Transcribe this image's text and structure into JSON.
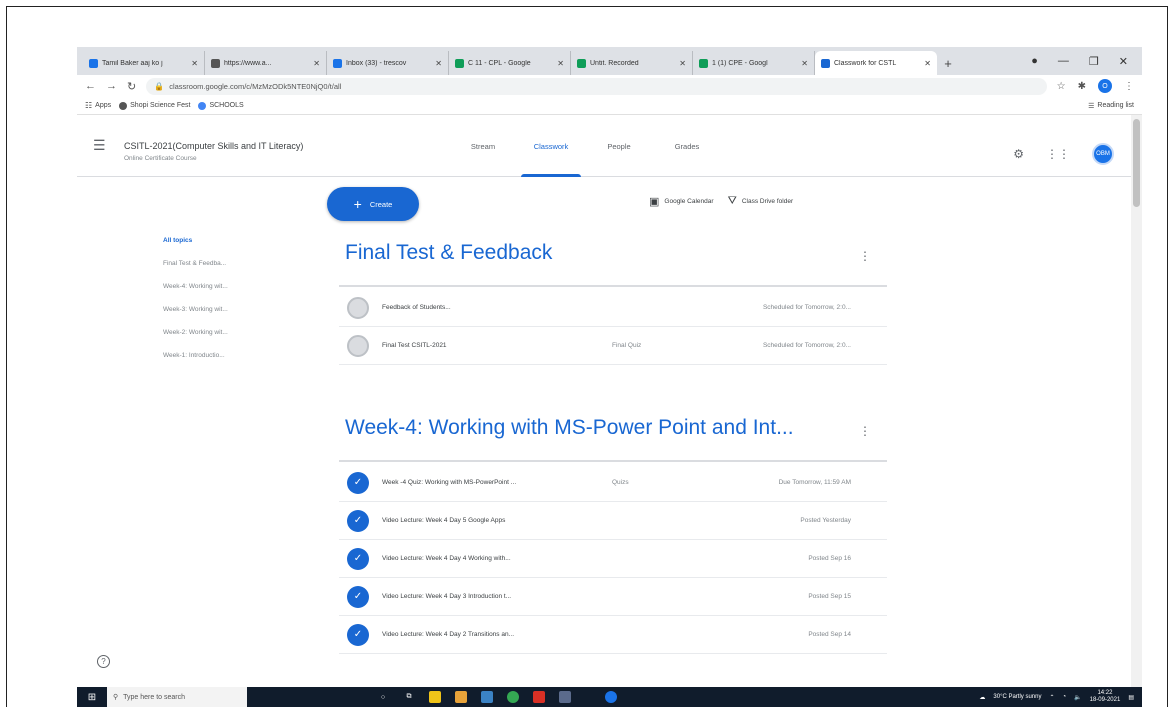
{
  "browser": {
    "tabs": [
      {
        "label": "Tamil Baker aaj ko j",
        "color": "#1a73e8",
        "active": false
      },
      {
        "label": "https://www.a...",
        "color": "#555555",
        "active": false
      },
      {
        "label": "Inbox (33) - trescov",
        "color": "#1a73e8",
        "active": false
      },
      {
        "label": "C 11 - CPL - Google",
        "color": "#0f9d58",
        "active": false
      },
      {
        "label": "Untit. Recorded",
        "color": "#0f9d58",
        "active": false
      },
      {
        "label": "1 (1) CPE - Googl",
        "color": "#0f9d58",
        "active": false
      },
      {
        "label": "Classwork for CSTL",
        "color": "#1967d2",
        "active": true
      }
    ],
    "new_tab": "+",
    "url": "classroom.google.com/c/MzMzODk5NTE0NjQ0/t/all",
    "bookmarks": [
      {
        "label": "Apps"
      },
      {
        "label": "Shopi Science Fest"
      },
      {
        "label": "SCHOOLS"
      }
    ],
    "reading_list": "Reading list"
  },
  "classroom": {
    "course_title": "CSITL-2021(Computer Skills and IT Literacy)",
    "course_subtitle": "Online Certificate Course",
    "nav": [
      "Stream",
      "Classwork",
      "People",
      "Grades"
    ],
    "active_nav": "Classwork",
    "avatar_text": "OBM",
    "create_label": "Create",
    "calendar_link": "Google Calendar",
    "drive_link": "Class Drive folder"
  },
  "topics": [
    {
      "label": "All topics",
      "active": true
    },
    {
      "label": "Final Test & Feedba...",
      "active": false
    },
    {
      "label": "Week-4: Working wit...",
      "active": false
    },
    {
      "label": "Week-3: Working wit...",
      "active": false
    },
    {
      "label": "Week-2: Working wit...",
      "active": false
    },
    {
      "label": "Week-1: Introductio...",
      "active": false
    }
  ],
  "sections": [
    {
      "title": "Final Test & Feedback",
      "items": [
        {
          "title": "Feedback of Students...",
          "tag": "",
          "status": "Scheduled for Tomorrow, 2:0...",
          "icon": "grey"
        },
        {
          "title": "Final Test CSITL-2021",
          "tag": "Final Quiz",
          "status": "Scheduled for Tomorrow, 2:0...",
          "icon": "grey"
        }
      ]
    },
    {
      "title": "Week-4: Working with MS-Power Point and Int...",
      "items": [
        {
          "title": "Week -4 Quiz: Working with MS-PowerPoint ...",
          "tag": "Quizs",
          "status": "Due Tomorrow, 11:59 AM",
          "icon": "blue"
        },
        {
          "title": "Video Lecture: Week 4 Day 5 Google Apps",
          "tag": "",
          "status": "Posted Yesterday",
          "icon": "blue"
        },
        {
          "title": "Video Lecture: Week 4 Day 4 Working with...",
          "tag": "",
          "status": "Posted Sep 16",
          "icon": "blue"
        },
        {
          "title": "Video Lecture: Week 4 Day 3 Introduction t...",
          "tag": "",
          "status": "Posted Sep 15",
          "icon": "blue"
        },
        {
          "title": "Video Lecture: Week 4 Day 2 Transitions an...",
          "tag": "",
          "status": "Posted Sep 14",
          "icon": "blue"
        }
      ]
    }
  ],
  "taskbar": {
    "search_placeholder": "Type here to search",
    "weather": "30°C Partly sunny",
    "time": "14:22",
    "date": "18-09-2021"
  }
}
